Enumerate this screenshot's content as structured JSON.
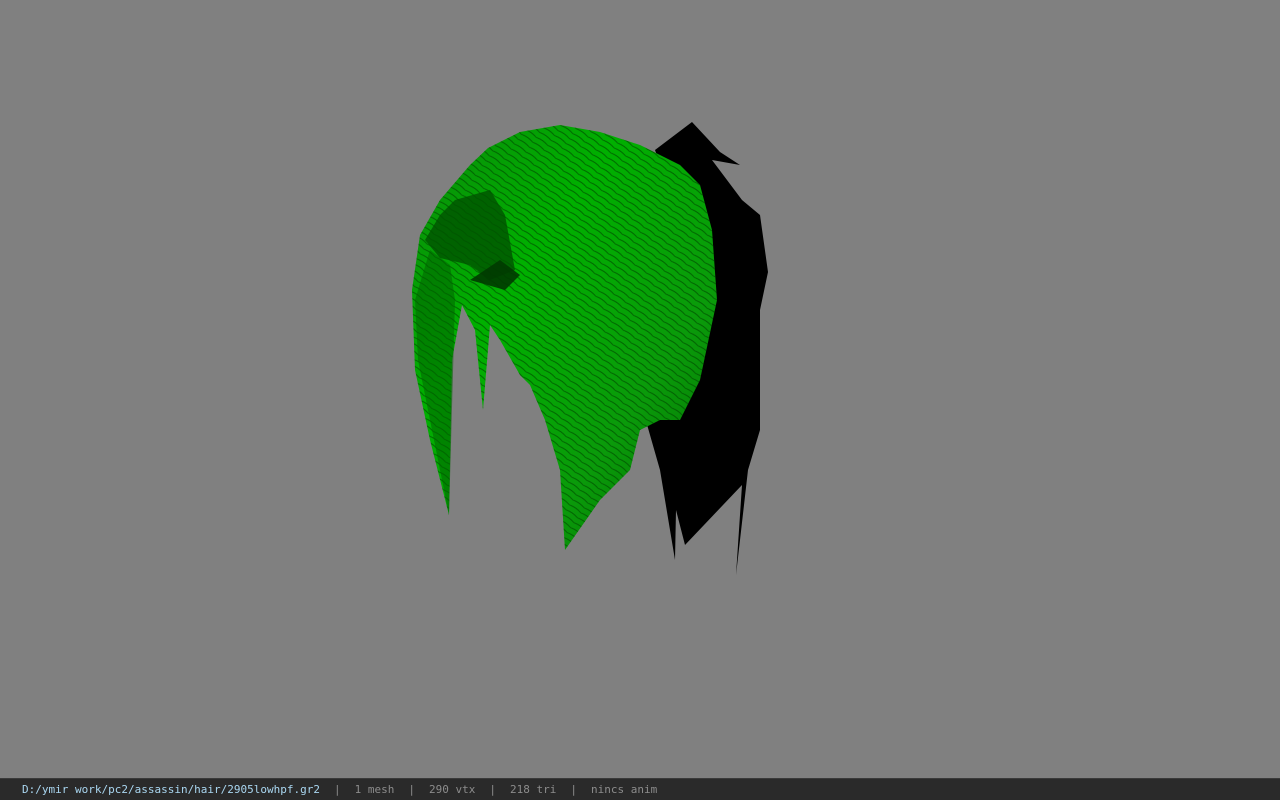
{
  "viewport": {
    "background_color": "#808080",
    "model": {
      "name": "hair-mesh",
      "front_color": "#00a300",
      "front_color_dark": "#005c00",
      "shadow_color": "#000000"
    }
  },
  "status_bar": {
    "file_path": "D:/ymir work/pc2/assassin/hair/2905lowhpf.gr2",
    "separator": "|",
    "mesh_count": "1 mesh",
    "vertex_count": "290 vtx",
    "triangle_count": "218 tri",
    "anim_status": "nincs anim"
  }
}
